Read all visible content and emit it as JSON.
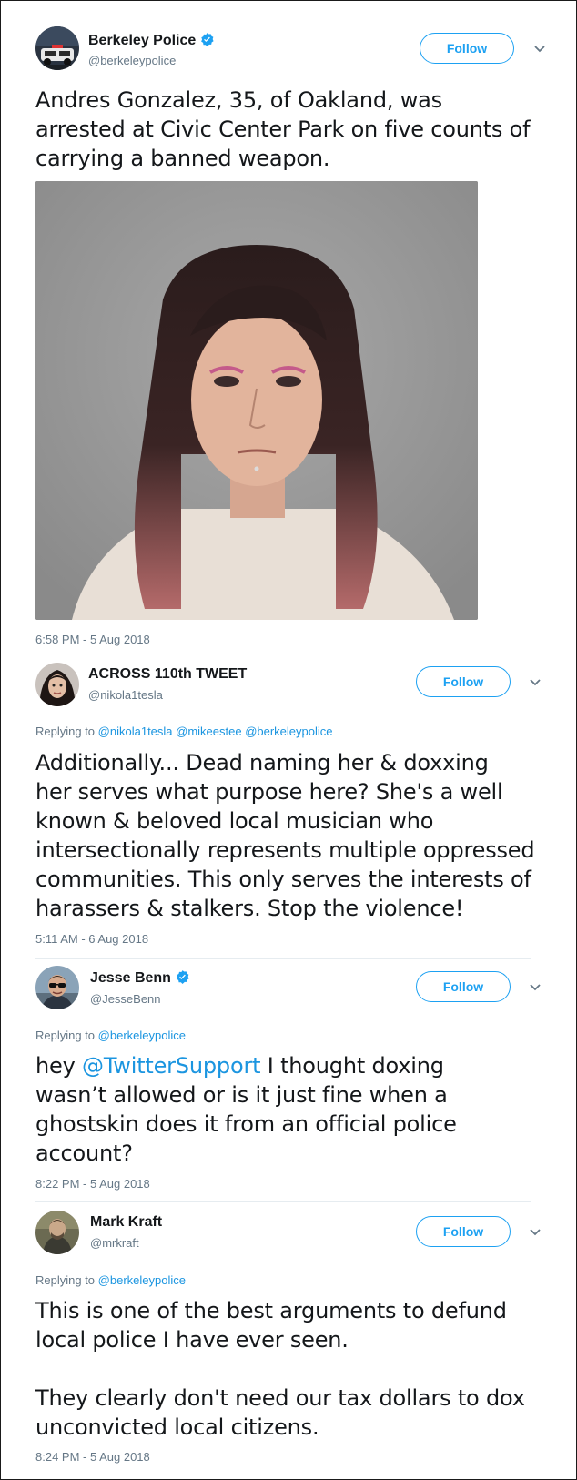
{
  "tweets": [
    {
      "name": "Berkeley Police",
      "handle": "@berkeleypolice",
      "verified": true,
      "follow_label": "Follow",
      "text_lines": [
        "Andres Gonzalez, 35, of Oakland, was",
        "arrested at Civic Center Park on five counts of",
        "carrying a banned weapon."
      ],
      "timestamp": "6:58 PM - 5 Aug 2018"
    },
    {
      "name": "ACROSS 110th TWEET",
      "handle": "@nikola1tesla",
      "follow_label": "Follow",
      "replying_prefix": "Replying to",
      "replying_to": "@nikola1tesla @mikeestee @berkeleypolice",
      "text_lines": [
        "Additionally... Dead naming her & doxxing",
        "her serves what purpose here?  She's a well",
        "known & beloved local musician who",
        "intersectionally represents multiple oppressed",
        "communities. This only serves the interests of",
        "harassers & stalkers. Stop the violence!"
      ],
      "timestamp": "5:11 AM - 6 Aug 2018"
    },
    {
      "name": "Jesse Benn",
      "handle": "@JesseBenn",
      "verified": true,
      "follow_label": "Follow",
      "replying_prefix": "Replying to",
      "replying_to": "@berkeleypolice",
      "text_line1_prefix": "hey ",
      "text_line1_mention": "@TwitterSupport",
      "text_line1_suffix": " I thought doxing",
      "text_lines_rest": [
        "wasn’t allowed or is it just fine when a",
        "ghostskin does it from an official police",
        "account?"
      ],
      "timestamp": "8:22 PM - 5 Aug 2018"
    },
    {
      "name": "Mark Kraft",
      "handle": "@mrkraft",
      "follow_label": "Follow",
      "replying_prefix": "Replying to",
      "replying_to": "@berkeleypolice",
      "text_lines": [
        "This is one of the best arguments to defund",
        "local police I have ever seen.",
        "",
        "They clearly don't need our tax dollars to dox",
        "unconvicted local citizens."
      ],
      "timestamp": "8:24 PM - 5 Aug 2018"
    }
  ],
  "colors": {
    "accent": "#1da1f2",
    "link": "#1b95e0",
    "secondary_text": "#657786",
    "primary_text": "#14171a"
  },
  "icons": {
    "verified": "verified-badge-icon",
    "chevron": "chevron-down-icon"
  }
}
